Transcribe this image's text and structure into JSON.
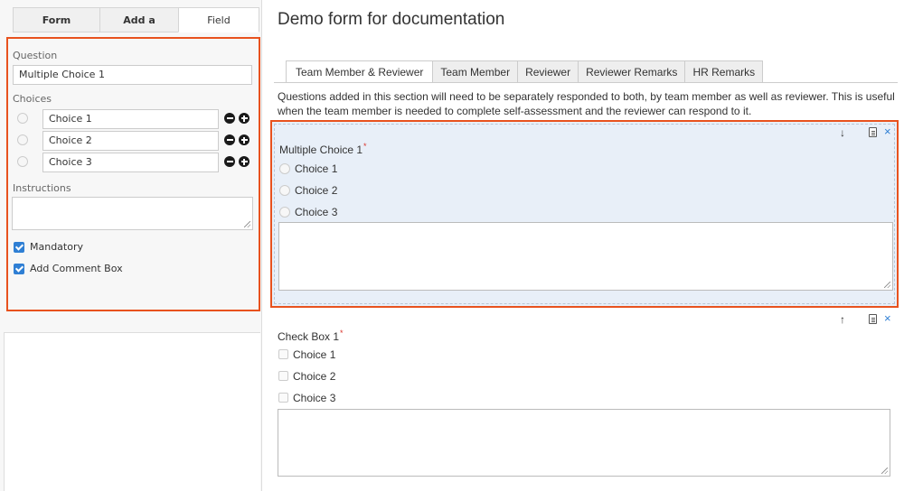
{
  "sidebar": {
    "tabs": [
      {
        "label": "Form Settings"
      },
      {
        "label": "Add a Field"
      },
      {
        "label": "Field Settings"
      }
    ],
    "question_label": "Question",
    "question_value": "Multiple Choice 1",
    "choices_label": "Choices",
    "choices": [
      {
        "value": "Choice 1"
      },
      {
        "value": "Choice 2"
      },
      {
        "value": "Choice 3"
      }
    ],
    "instructions_label": "Instructions",
    "instructions_value": "",
    "mandatory_label": "Mandatory",
    "mandatory_checked": true,
    "comment_box_label": "Add Comment Box",
    "comment_box_checked": true,
    "accent_color": "#e8521e",
    "checkbox_color": "#2f7fd4"
  },
  "main": {
    "title": "Demo form for documentation",
    "tabs": [
      {
        "label": "Team Member & Reviewer",
        "active": true
      },
      {
        "label": "Team Member"
      },
      {
        "label": "Reviewer"
      },
      {
        "label": "Reviewer Remarks"
      },
      {
        "label": "HR Remarks"
      }
    ],
    "description": "Questions added in this section will need to be separately responded to both, by team member as well as reviewer. This is useful when the team member is needed to complete self-assessment and the reviewer can respond to it.",
    "questions": [
      {
        "title": "Multiple Choice 1",
        "required_mark": "*",
        "type": "radio",
        "options": [
          "Choice 1",
          "Choice 2",
          "Choice 3"
        ],
        "selected": true,
        "move_icon": "arrow-down-icon",
        "bg_color": "#e8eff8"
      },
      {
        "title": "Check Box 1",
        "required_mark": "*",
        "type": "checkbox",
        "options": [
          "Choice 1",
          "Choice 2",
          "Choice 3"
        ],
        "selected": false,
        "move_icon": "arrow-up-icon"
      }
    ]
  }
}
